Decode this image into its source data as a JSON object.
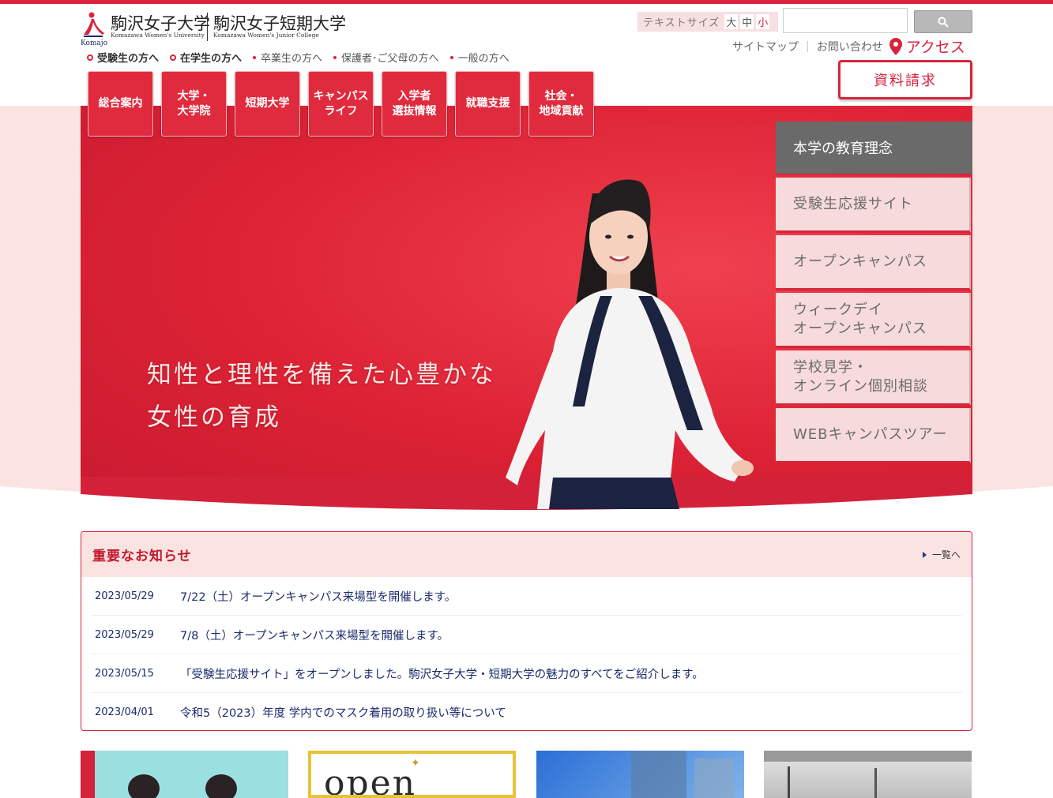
{
  "logo": {
    "mark_text": "Komajo",
    "name_univ": "駒沢女子大学",
    "sub_univ": "Komazawa Women's University",
    "name_college": "駒沢女子短期大学",
    "sub_college": "Komazawa Women's Junior College"
  },
  "audience": [
    {
      "label": "受験生の方へ",
      "strong": true
    },
    {
      "label": "在学生の方へ",
      "strong": true
    },
    {
      "label": "卒業生の方へ",
      "strong": false
    },
    {
      "label": "保護者･ご父母の方へ",
      "strong": false
    },
    {
      "label": "一般の方へ",
      "strong": false
    }
  ],
  "text_size": {
    "label": "テキストサイズ",
    "large": "大",
    "medium": "中",
    "small": "小"
  },
  "search": {
    "placeholder": ""
  },
  "util": {
    "sitemap": "サイトマップ",
    "contact": "お問い合わせ",
    "access": "アクセス"
  },
  "request_button": "資料請求",
  "nav": [
    "総合案内",
    "大学・\n大学院",
    "短期大学",
    "キャンパス\nライフ",
    "入学者\n選抜情報",
    "就職支援",
    "社会・\n地域貢献"
  ],
  "slogan": {
    "line1": "知性と理性を備えた心豊かな",
    "line2": "女性の育成"
  },
  "side_menu": {
    "head": "本学の教育理念",
    "items": [
      "受験生応援サイト",
      "オープンキャンパス",
      "ウィークデイ\nオープンキャンパス",
      "学校見学・\nオンライン個別相談",
      "WEBキャンパスツアー"
    ]
  },
  "news": {
    "title": "重要なお知らせ",
    "more": "一覧へ",
    "items": [
      {
        "date": "2023/05/29",
        "text": "7/22（土）オープンキャンパス来場型を開催します。"
      },
      {
        "date": "2023/05/29",
        "text": "7/8（土）オープンキャンパス来場型を開催します。"
      },
      {
        "date": "2023/05/15",
        "text": "「受験生応援サイト」をオープンしました。駒沢女子大学・短期大学の魅力のすべてをご紹介します。"
      },
      {
        "date": "2023/04/01",
        "text": "令和5（2023）年度 学内でのマスク着用の取り扱い等について"
      }
    ]
  },
  "cards": {
    "card2_text": "open"
  },
  "colors": {
    "brand_red": "#d8243c",
    "pink_bg": "#fbe3e2",
    "navy_text": "#1a2a6c"
  }
}
